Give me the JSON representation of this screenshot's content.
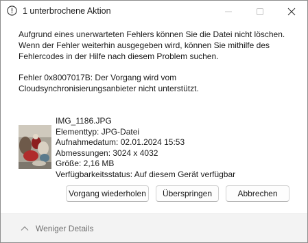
{
  "window": {
    "title": "1 unterbrochene Aktion"
  },
  "message": {
    "main": "Aufgrund eines unerwarteten Fehlers können Sie die Datei nicht löschen. Wenn der Fehler weiterhin ausgegeben wird, können Sie mithilfe des Fehlercodes in der Hilfe nach diesem Problem suchen.",
    "error": "Fehler 0x8007017B: Der Vorgang wird vom Cloudsynchronisierungsanbieter nicht unterstützt."
  },
  "file": {
    "name": "IMG_1186.JPG",
    "type": "Elementtyp: JPG-Datei",
    "date": "Aufnahmedatum: 02.01.2024 15:53",
    "dimensions": "Abmessungen: 3024 x 4032",
    "size": "Größe: 2,16 MB",
    "availability": "Verfügbarkeitsstatus: Auf diesem Gerät verfügbar"
  },
  "buttons": {
    "retry": "Vorgang wiederholen",
    "skip": "Überspringen",
    "cancel": "Abbrechen"
  },
  "footer": {
    "toggle_label": "Weniger Details"
  },
  "icons": {
    "title": "warning-icon",
    "minimize": "minimize-icon",
    "maximize": "maximize-icon",
    "close": "close-icon",
    "toggle": "chevron-up-icon"
  },
  "colors": {
    "window_bg": "#ffffff",
    "footer_bg": "#f3f3f3",
    "muted_text": "#707070"
  }
}
